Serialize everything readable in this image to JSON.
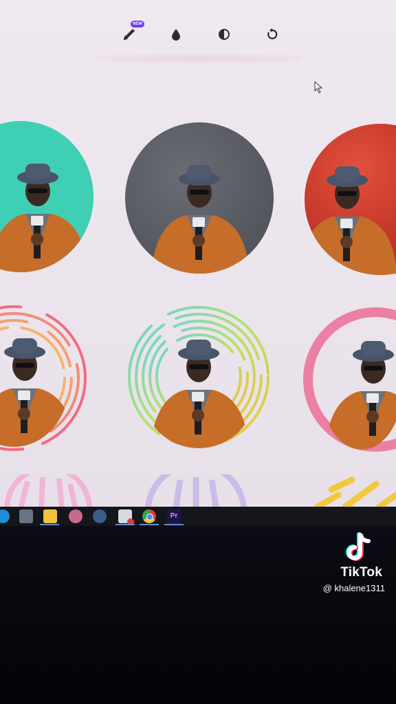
{
  "toolbar": {
    "tools": [
      {
        "icon": "brush-icon",
        "badge": "NEW"
      },
      {
        "icon": "droplet-icon"
      },
      {
        "icon": "contrast-icon"
      },
      {
        "icon": "rotate-icon"
      }
    ]
  },
  "avatars": [
    {
      "style": "solid",
      "color": "#3fcfb4"
    },
    {
      "style": "solid",
      "color": "#55575f"
    },
    {
      "style": "gradient",
      "color": "#d23a2a"
    },
    {
      "style": "line-rings",
      "color": "#f07a8a"
    },
    {
      "style": "rainbow-rings",
      "color": "#6ad0e0"
    },
    {
      "style": "thick-ring",
      "color": "#ec7fa4"
    }
  ],
  "taskbar": {
    "apps": [
      "windows-icon",
      "calculator-icon",
      "file-explorer-icon",
      "app-icon",
      "steam-icon",
      "notification-app-icon",
      "chrome-icon",
      "premiere-pro-icon"
    ],
    "premiere_label": "Pr"
  },
  "watermark": {
    "brand": "TikTok",
    "username": "@ khalene1311"
  }
}
